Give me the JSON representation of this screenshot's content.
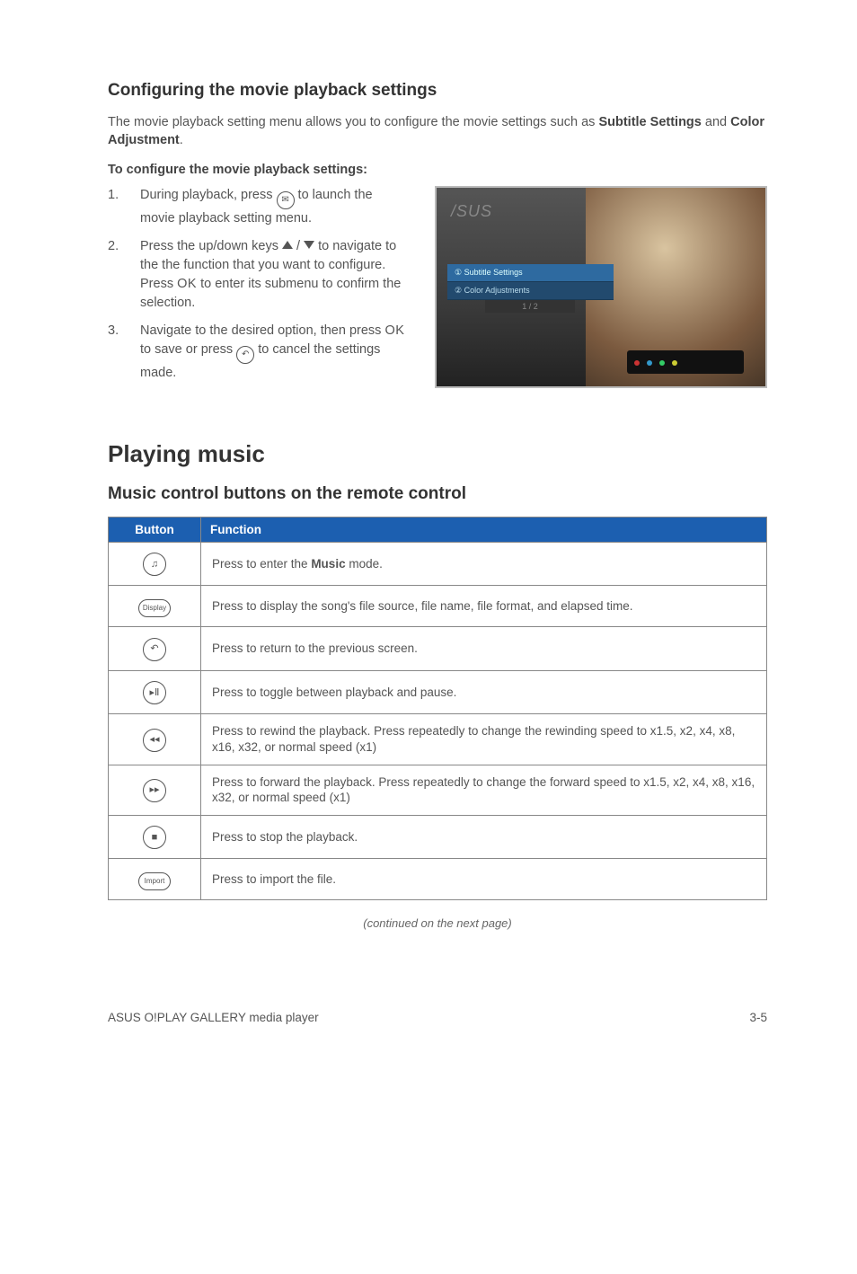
{
  "headings": {
    "configure": "Configuring the movie playback settings",
    "playing_music": "Playing music",
    "music_controls": "Music control buttons on the remote control"
  },
  "intro": {
    "pre": "The movie playback setting menu allows you to configure the movie settings such as ",
    "b1": "Subtitle Settings",
    "and": " and ",
    "b2": "Color Adjustment",
    "post": "."
  },
  "subhead": "To configure the movie playback settings:",
  "steps": {
    "s1a": "During playback, press ",
    "s1b": " to launch the movie playback setting menu.",
    "s2a": "Press the up/down keys ",
    "s2slash": " / ",
    "s2b": " to navigate to the the function that you want to configure. Press ",
    "s2c": " to enter its submenu to confirm the selection.",
    "s3a": "Navigate to the desired option, then press ",
    "s3b": " to save or press ",
    "s3c": " to cancel the settings made."
  },
  "ok_label": "OK",
  "mock": {
    "logo": "/SUS",
    "row1": "① Subtitle Settings",
    "row2": "② Color Adjustments",
    "page": "1 / 2"
  },
  "table": {
    "hdr_button": "Button",
    "hdr_function": "Function",
    "rows": [
      {
        "icon": "music",
        "pre": "Press to enter the ",
        "bold": "Music",
        "post": " mode."
      },
      {
        "icon": "display",
        "text": "Press to display the song's file source, file name, file format, and elapsed time."
      },
      {
        "icon": "back",
        "text": "Press to return to the previous screen."
      },
      {
        "icon": "play",
        "text": "Press to toggle between playback and pause."
      },
      {
        "icon": "rew",
        "text": "Press to rewind the playback. Press repeatedly to change the rewinding speed to x1.5, x2, x4, x8, x16, x32, or normal speed (x1)"
      },
      {
        "icon": "fwd",
        "text": "Press to forward the playback. Press repeatedly to change the forward speed to x1.5, x2, x4, x8, x16, x32, or normal speed (x1)"
      },
      {
        "icon": "stop",
        "text": "Press to stop the playback."
      },
      {
        "icon": "import",
        "text": "Press to import the file."
      }
    ]
  },
  "continued": "(continued on the next page)",
  "footer": {
    "left": "ASUS O!PLAY GALLERY media player",
    "right": "3-5"
  }
}
